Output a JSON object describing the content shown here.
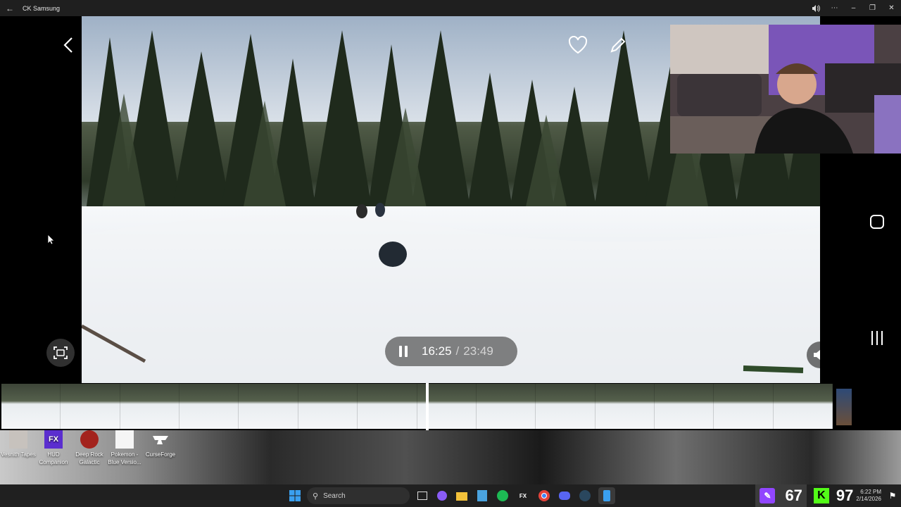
{
  "window": {
    "title": "CK Samsung",
    "back_icon": "back-arrow-icon"
  },
  "titlebar_controls": [
    "volume-icon",
    "more-icon",
    "minimize-icon",
    "restore-icon",
    "close-icon"
  ],
  "player": {
    "current_time": "16:25",
    "separator": "/",
    "total_time": "23:49"
  },
  "desktop_icons": [
    {
      "label": "Vesnith Tapes"
    },
    {
      "label": "HUD Companion"
    },
    {
      "label": "Deep Rock Galactic"
    },
    {
      "label": "Pokemon - Blue Versio..."
    },
    {
      "label": "CurseForge"
    }
  ],
  "taskbar": {
    "search_placeholder": "Search",
    "clock_time": "6:22 PM",
    "clock_date": "2/14/2026"
  },
  "overlay_scores": {
    "twitch_count": "67",
    "kick_count": "97"
  },
  "colors": {
    "twitch": "#9146ff",
    "kick": "#53fc18",
    "taskbar": "#202020"
  }
}
